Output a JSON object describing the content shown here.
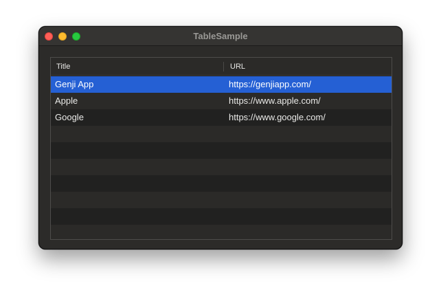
{
  "window": {
    "title": "TableSample"
  },
  "table": {
    "columns": [
      "Title",
      "URL"
    ],
    "rows": [
      {
        "title": "Genji App",
        "url": "https://genjiapp.com/",
        "selected": true
      },
      {
        "title": "Apple",
        "url": "https://www.apple.com/",
        "selected": false
      },
      {
        "title": "Google",
        "url": "https://www.google.com/",
        "selected": false
      }
    ],
    "empty_rows": 7
  },
  "colors": {
    "selection": "#2560d4",
    "close": "#fe5f57",
    "minimize": "#febc2e",
    "zoom": "#28c840"
  }
}
